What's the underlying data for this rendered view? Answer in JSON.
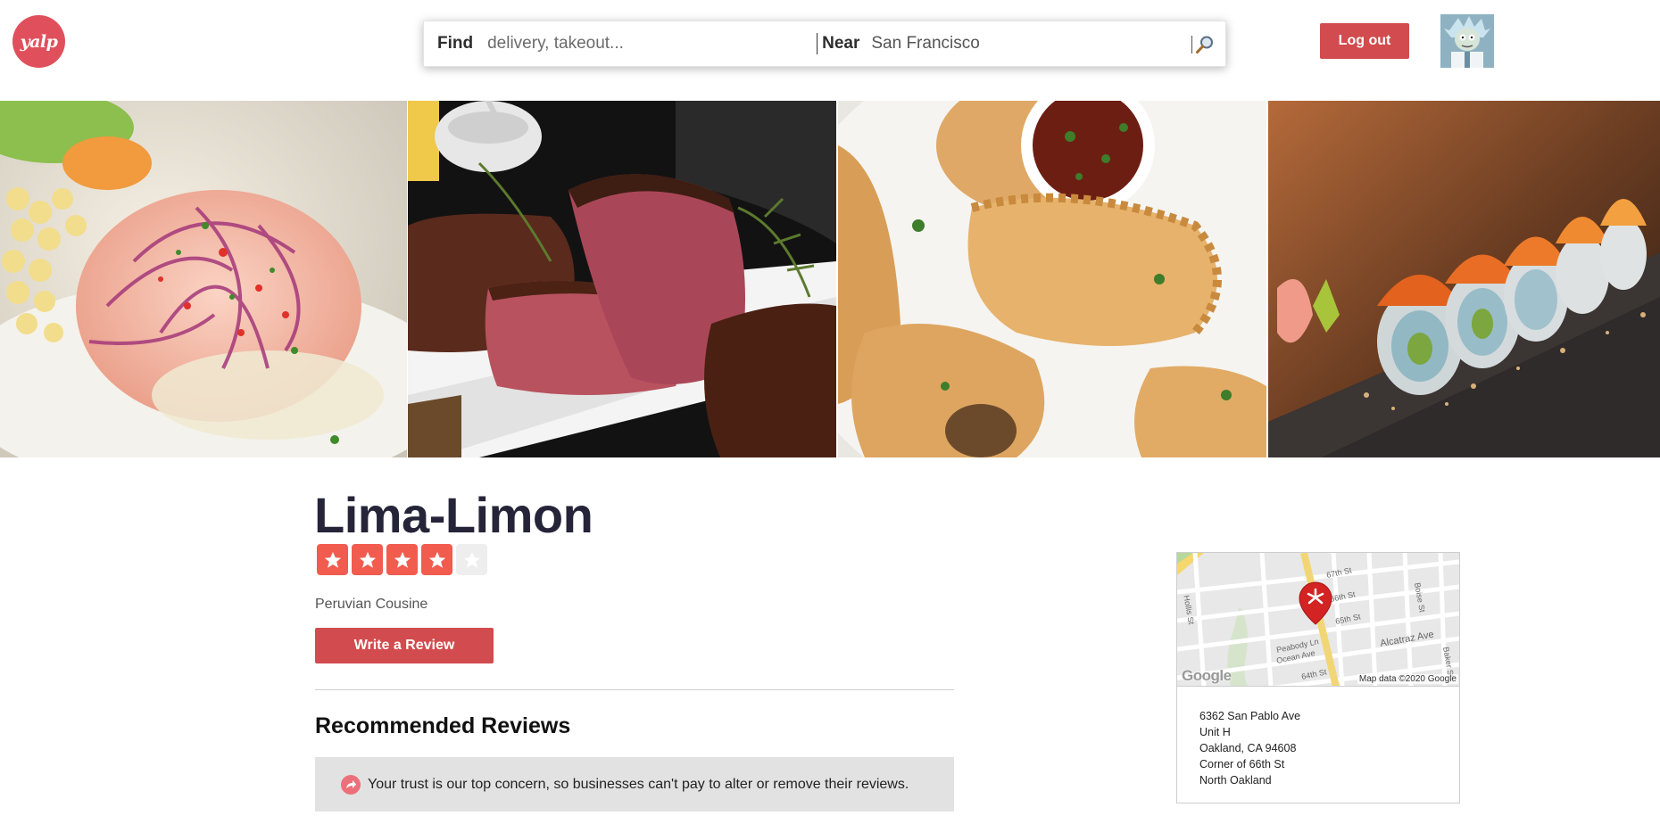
{
  "header": {
    "logo_text": "yalp",
    "search": {
      "find_label": "Find",
      "find_placeholder": "delivery, takeout...",
      "near_label": "Near",
      "near_value": "San Francisco",
      "search_icon": "magnifier-icon"
    },
    "logout_label": "Log out",
    "avatar_icon": "user-avatar"
  },
  "photos": [
    {
      "name": "ceviche-photo"
    },
    {
      "name": "steak-photo"
    },
    {
      "name": "empanadas-photo"
    },
    {
      "name": "sushi-roll-photo"
    }
  ],
  "business": {
    "name": "Lima-Limon",
    "rating": 4,
    "rating_max": 5,
    "category": "Peruvian Cousine",
    "write_review_label": "Write a Review"
  },
  "reviews": {
    "title": "Recommended Reviews",
    "trust_notice": "Your trust is our top concern, so businesses can't pay to alter or remove their reviews.",
    "trust_icon": "share-arrow-icon"
  },
  "map": {
    "streets": [
      "Hollis St",
      "67th St",
      "66th St",
      "65th St",
      "Peabody Ln",
      "Ocean Ave",
      "64th St",
      "Alcatraz Ave",
      "Boise St",
      "Baker St"
    ],
    "google_label": "Google",
    "attribution": "Map data ©2020 Google",
    "marker_icon": "yelp-marker-icon"
  },
  "address": {
    "line1": "6362 San Pablo Ave",
    "line2": "Unit H",
    "line3": "Oakland, CA 94608",
    "line4": "Corner of 66th St",
    "line5": "North Oakland"
  },
  "colors": {
    "brand_red": "#d24b4e",
    "logo_red": "#e0505c",
    "star_red": "#f15c4f",
    "star_empty": "#eeeeee",
    "title_dark": "#262438"
  }
}
